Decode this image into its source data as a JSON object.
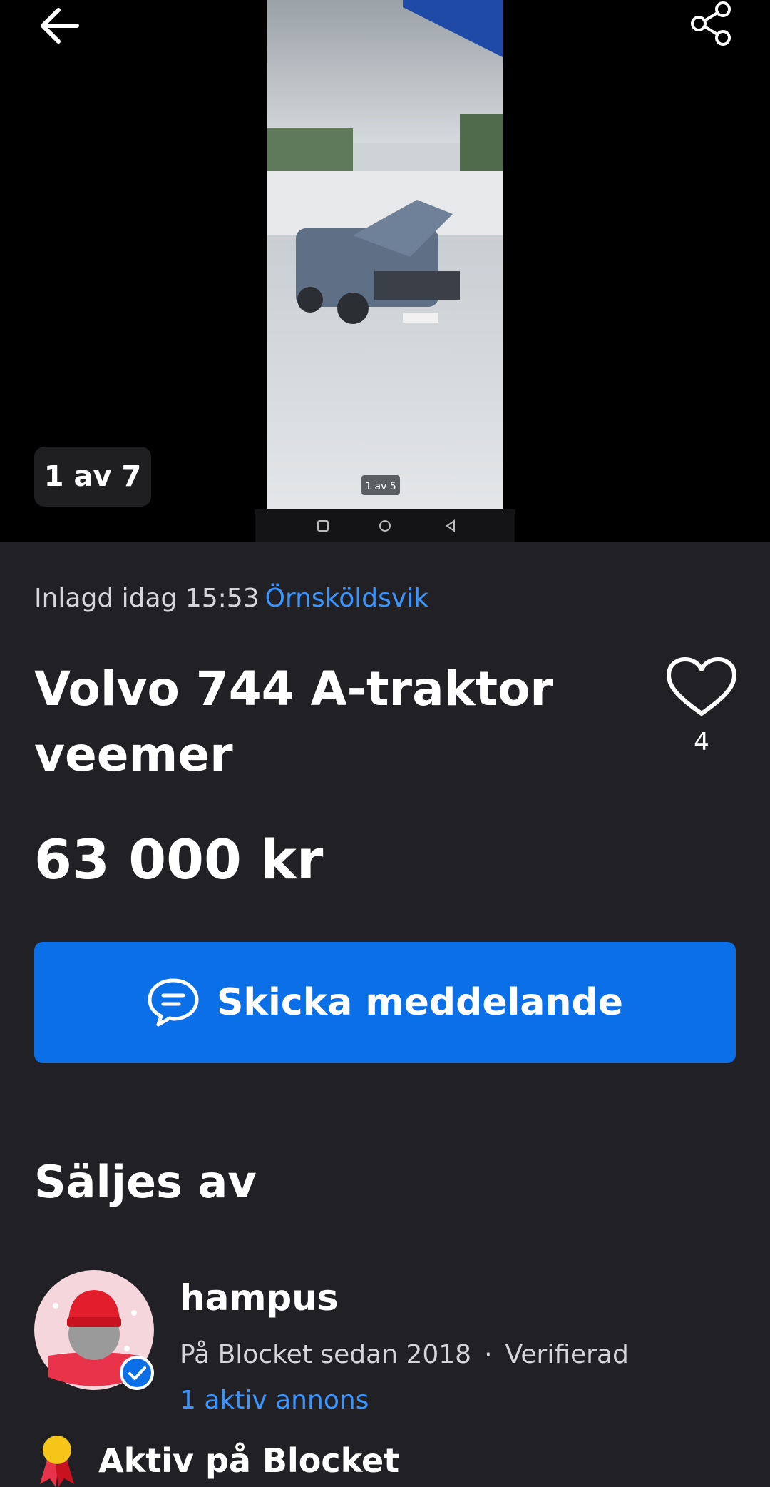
{
  "gallery": {
    "counter": "1 av 7",
    "inner_counter": "1 av 5"
  },
  "listing": {
    "posted_label": "Inlagd idag 15:53",
    "location": "Örnsköldsvik",
    "title": "Volvo 744 A-traktor veemer",
    "favorites_count": "4",
    "price": "63 000 kr"
  },
  "actions": {
    "message_label": "Skicka meddelande"
  },
  "seller": {
    "heading": "Säljes av",
    "name": "hampus",
    "since": "På Blocket sedan 2018",
    "separator": "·",
    "verified": "Verifierad",
    "active_ads": "1 aktiv annons",
    "badge_label": "Aktiv på Blocket"
  },
  "icons": {
    "back": "arrow-left-icon",
    "share": "share-icon",
    "favorite": "heart-icon",
    "message": "chat-bubble-icon",
    "verified": "verified-check-icon",
    "badge": "award-ribbon-icon"
  },
  "colors": {
    "background": "#212125",
    "accent": "#0b6fe8",
    "link": "#3b95ff"
  }
}
